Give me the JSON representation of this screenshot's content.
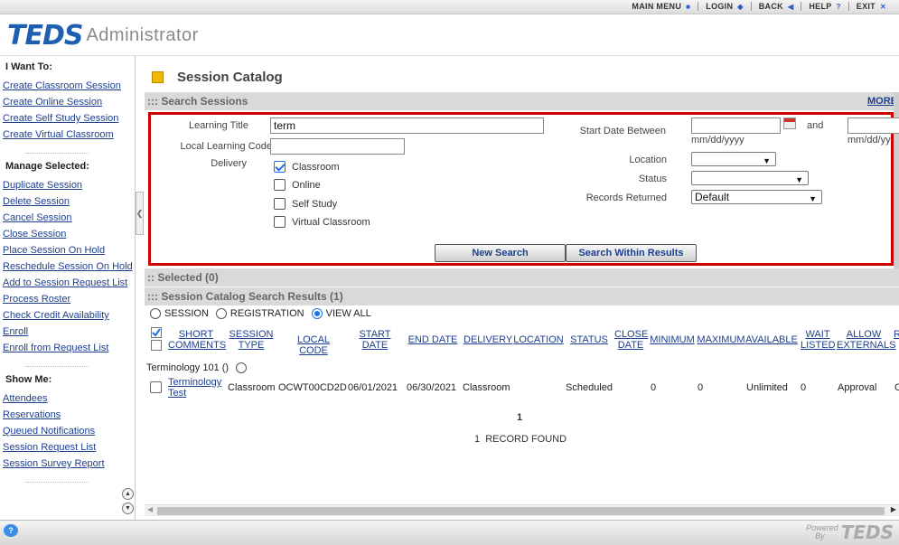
{
  "topnav": {
    "main_menu": "MAIN MENU",
    "login": "LOGIN",
    "back": "BACK",
    "help": "HELP",
    "exit": "EXIT"
  },
  "header": {
    "logo_text": "TEDS",
    "app_title": "Administrator"
  },
  "sidebar": {
    "want_to_heading": "I Want To:",
    "want_to_links": [
      "Create Classroom Session",
      "Create Online Session",
      "Create Self Study Session",
      "Create Virtual Classroom"
    ],
    "manage_heading": "Manage Selected:",
    "manage_links": [
      "Duplicate Session",
      "Delete Session",
      "Cancel Session",
      "Close Session",
      "Place Session On Hold",
      "Reschedule Session On Hold",
      "Add to Session Request List",
      "Process Roster",
      "Check Credit Availability",
      "Enroll",
      "Enroll from Request List"
    ],
    "show_heading": "Show Me:",
    "show_links": [
      "Attendees",
      "Reservations",
      "Queued Notifications",
      "Session Request List",
      "Session Survey Report"
    ]
  },
  "page": {
    "title": "Session Catalog"
  },
  "search_section": {
    "title": "::: Search Sessions",
    "more": "MORE",
    "learning_title_label": "Learning Title",
    "learning_title_value": "term",
    "local_code_label": "Local Learning Code",
    "local_code_value": "",
    "delivery_label": "Delivery",
    "delivery_options": [
      {
        "label": "Classroom",
        "checked": true
      },
      {
        "label": "Online",
        "checked": false
      },
      {
        "label": "Self Study",
        "checked": false
      },
      {
        "label": "Virtual Classroom",
        "checked": false
      }
    ],
    "start_date_label": "Start Date Between",
    "date_hint": "mm/dd/yyyy",
    "date_hint_2": "mm/dd/yy",
    "and_label": "and",
    "location_label": "Location",
    "location_value": "",
    "status_label": "Status",
    "status_value": "",
    "records_label": "Records Returned",
    "records_value": "Default",
    "new_search_button": "New Search",
    "within_results_button": "Search Within Results"
  },
  "selected_section": {
    "title": ":: Selected (0)"
  },
  "results_section": {
    "title": "::: Session Catalog Search Results (1)",
    "view_options": [
      {
        "label": "SESSION",
        "selected": false
      },
      {
        "label": "REGISTRATION",
        "selected": false
      },
      {
        "label": "VIEW ALL",
        "selected": true
      }
    ],
    "columns": [
      "SHORT COMMENTS",
      "SESSION TYPE",
      "LOCAL CODE",
      "START DATE",
      "END DATE",
      "DELIVERY",
      "LOCATION",
      "STATUS",
      "CLOSE DATE",
      "MINIMUM",
      "MAXIMUM",
      "AVAILABLE",
      "WAIT LISTED",
      "ALLOW EXTERNALS",
      "R"
    ],
    "group_label": "Terminology 101 ()",
    "rows": [
      {
        "title_line1": "Terminology",
        "title_line2": "Test",
        "session_type": "Classroom",
        "local_code": "OCWT00CD2D",
        "start_date": "06/01/2021",
        "end_date": "06/30/2021",
        "delivery": "Classroom",
        "location": "",
        "status": "Scheduled",
        "close_date": "",
        "minimum": "0",
        "maximum": "0",
        "available": "Unlimited",
        "wait_listed": "0",
        "allow_externals": "Approval",
        "r": "C"
      }
    ],
    "page_number": "1",
    "record_count": "1  RECORD FOUND"
  },
  "footer": {
    "help_icon": "?",
    "powered_line1": "Powered",
    "powered_line2": "By",
    "powered_logo": "TEDS"
  },
  "colors": {
    "accent_red_border": "#cc0000",
    "link_blue": "#1c3f8f",
    "brand_blue": "#1f5fb0",
    "section_gray": "#d9d9d9"
  }
}
